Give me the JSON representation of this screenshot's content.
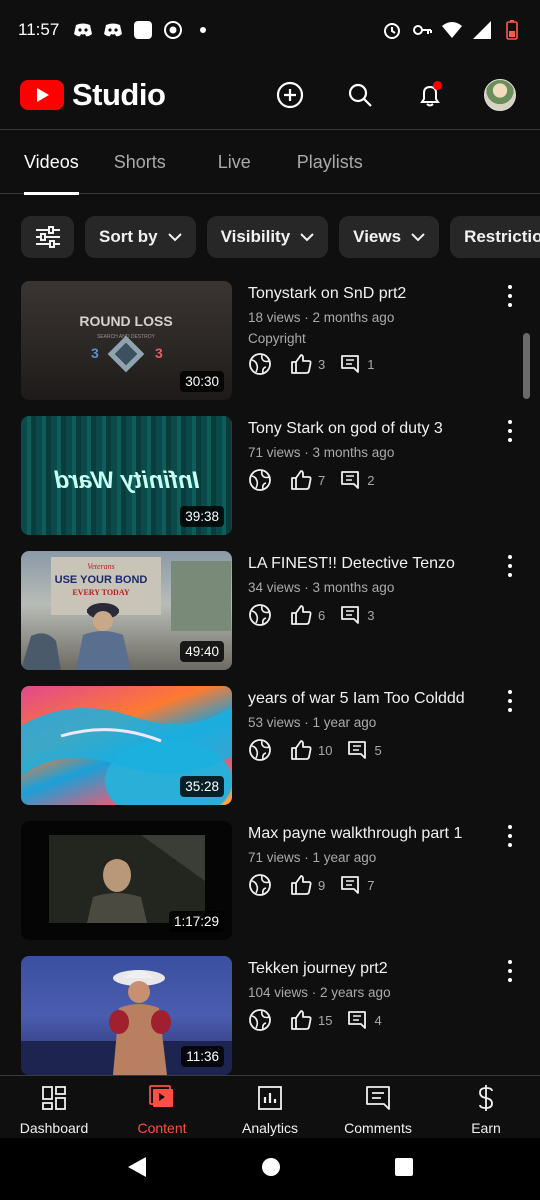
{
  "status_bar": {
    "time": "11:57",
    "left_icons": [
      "discord-icon",
      "discord-icon",
      "app-icon",
      "record-icon",
      "dot-icon"
    ],
    "right_icons": [
      "alarm-icon",
      "vpn-key-icon",
      "wifi-icon",
      "signal-icon",
      "battery-low-icon"
    ]
  },
  "header": {
    "logo_text": "Studio",
    "brand_color": "#ff0000",
    "actions": [
      "create-icon",
      "search-icon",
      "notifications-icon",
      "avatar"
    ]
  },
  "tabs": [
    {
      "label": "Videos",
      "active": true
    },
    {
      "label": "Shorts",
      "active": false
    },
    {
      "label": "Live",
      "active": false
    },
    {
      "label": "Playlists",
      "active": false
    }
  ],
  "filters": {
    "filter_icon": "filter-sliders-icon",
    "chips": [
      "Sort by",
      "Visibility",
      "Views",
      "Restriction"
    ]
  },
  "videos": [
    {
      "title": "Tonystark on SnD prt2",
      "meta": "18 views · 2 months ago",
      "extra": "Copyright",
      "duration": "30:30",
      "likes": "3",
      "comments": "1",
      "thumb_text": "ROUND LOSS",
      "thumb_sub": "SEARCH AND DESTROY",
      "score_left": "3",
      "score_right": "3"
    },
    {
      "title": "Tony Stark on god of duty 3",
      "meta": "71 views · 3 months ago",
      "extra": "",
      "duration": "39:38",
      "likes": "7",
      "comments": "2",
      "thumb_text": "Infinity Ward"
    },
    {
      "title": "LA FINEST!! Detective Tenzo",
      "meta": "34 views · 3 months ago",
      "extra": "",
      "duration": "49:40",
      "likes": "6",
      "comments": "3",
      "thumb_text": "USE YOUR BOND",
      "thumb_sub": "Veterans",
      "thumb_sub2": "EVERY TODAY"
    },
    {
      "title": "years of war 5 Iam Too Colddd",
      "meta": "53 views · 1 year ago",
      "extra": "",
      "duration": "35:28",
      "likes": "10",
      "comments": "5"
    },
    {
      "title": "Max payne walkthrough part 1",
      "meta": "71 views · 1 year ago",
      "extra": "",
      "duration": "1:17:29",
      "likes": "9",
      "comments": "7"
    },
    {
      "title": "Tekken journey prt2",
      "meta": "104 views · 2 years ago",
      "extra": "",
      "duration": "11:36",
      "likes": "15",
      "comments": "4"
    }
  ],
  "bottom_nav": [
    {
      "label": "Dashboard",
      "icon": "dashboard-icon",
      "active": false
    },
    {
      "label": "Content",
      "icon": "content-icon",
      "active": true
    },
    {
      "label": "Analytics",
      "icon": "analytics-icon",
      "active": false
    },
    {
      "label": "Comments",
      "icon": "comments-icon",
      "active": false
    },
    {
      "label": "Earn",
      "icon": "earn-icon",
      "active": false
    }
  ],
  "accent_color": "#ff4e45"
}
